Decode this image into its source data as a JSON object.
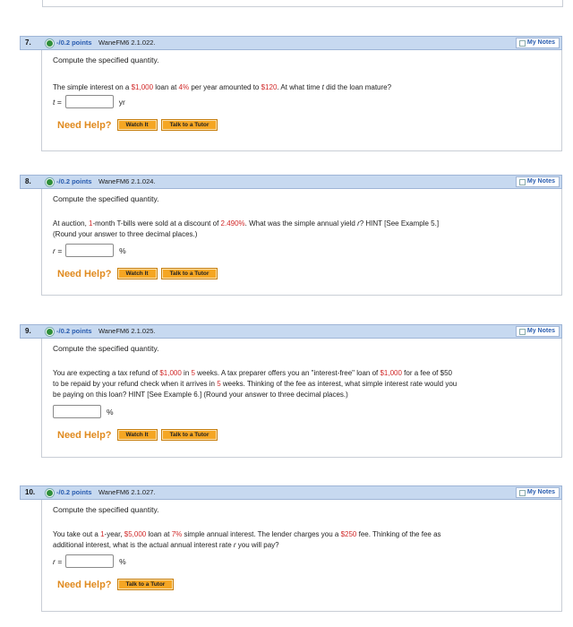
{
  "questions": [
    {
      "number": "7.",
      "points": "-/0.2 points",
      "code": "WaneFM6 2.1.022.",
      "my_notes": "My Notes",
      "prompt": "Compute the specified quantity.",
      "text_segments": [
        {
          "t": "The simple interest on a ",
          "style": ""
        },
        {
          "t": "$1,000",
          "style": "red"
        },
        {
          "t": " loan at ",
          "style": ""
        },
        {
          "t": "4%",
          "style": "red"
        },
        {
          "t": " per year amounted to ",
          "style": ""
        },
        {
          "t": "$120",
          "style": "red"
        },
        {
          "t": ". At what time ",
          "style": ""
        },
        {
          "t": "t",
          "style": "var"
        },
        {
          "t": " did the loan mature?",
          "style": ""
        }
      ],
      "answer_prefix": "t =",
      "answer_unit": "yr",
      "answer_value": "",
      "need_help": "Need Help?",
      "buttons": [
        "Watch It",
        "Talk to a Tutor"
      ]
    },
    {
      "number": "8.",
      "points": "-/0.2 points",
      "code": "WaneFM6 2.1.024.",
      "my_notes": "My Notes",
      "prompt": "Compute the specified quantity.",
      "text_segments": [
        {
          "t": "At auction, ",
          "style": ""
        },
        {
          "t": "1",
          "style": "red"
        },
        {
          "t": "-month T-bills were sold at a discount of ",
          "style": ""
        },
        {
          "t": "2.490%",
          "style": "red"
        },
        {
          "t": ". What was the simple annual yield ",
          "style": ""
        },
        {
          "t": "r",
          "style": "var"
        },
        {
          "t": "? HINT [See Example 5.]",
          "style": ""
        },
        {
          "t": "\n(Round your answer to three decimal places.)",
          "style": ""
        }
      ],
      "answer_prefix": "r =",
      "answer_unit": "%",
      "answer_value": "",
      "need_help": "Need Help?",
      "buttons": [
        "Watch It",
        "Talk to a Tutor"
      ]
    },
    {
      "number": "9.",
      "points": "-/0.2 points",
      "code": "WaneFM6 2.1.025.",
      "my_notes": "My Notes",
      "prompt": "Compute the specified quantity.",
      "text_segments": [
        {
          "t": "You are expecting a tax refund of ",
          "style": ""
        },
        {
          "t": "$1,000",
          "style": "red"
        },
        {
          "t": " in ",
          "style": ""
        },
        {
          "t": "5",
          "style": "red"
        },
        {
          "t": " weeks. A tax preparer offers you an \"interest-free\" loan of ",
          "style": ""
        },
        {
          "t": "$1,000",
          "style": "red"
        },
        {
          "t": " for a fee of $50",
          "style": ""
        },
        {
          "t": "\nto be repaid by your refund check when it arrives in ",
          "style": ""
        },
        {
          "t": "5",
          "style": "red"
        },
        {
          "t": " weeks. Thinking of the fee as interest, what simple interest rate would you",
          "style": ""
        },
        {
          "t": "\nbe paying on this loan? HINT [See Example 6.] (Round your answer to three decimal places.)",
          "style": ""
        }
      ],
      "answer_prefix": "",
      "answer_unit": "%",
      "answer_value": "",
      "need_help": "Need Help?",
      "buttons": [
        "Watch It",
        "Talk to a Tutor"
      ]
    },
    {
      "number": "10.",
      "points": "-/0.2 points",
      "code": "WaneFM6 2.1.027.",
      "my_notes": "My Notes",
      "prompt": "Compute the specified quantity.",
      "text_segments": [
        {
          "t": "You take out a ",
          "style": ""
        },
        {
          "t": "1",
          "style": "red"
        },
        {
          "t": "-year, ",
          "style": ""
        },
        {
          "t": "$5,000",
          "style": "red"
        },
        {
          "t": " loan at ",
          "style": ""
        },
        {
          "t": "7%",
          "style": "red"
        },
        {
          "t": " simple annual interest. The lender charges you a ",
          "style": ""
        },
        {
          "t": "$250",
          "style": "red"
        },
        {
          "t": " fee. Thinking of the fee as",
          "style": ""
        },
        {
          "t": "\nadditional interest, what is the actual annual interest rate ",
          "style": ""
        },
        {
          "t": "r",
          "style": "var"
        },
        {
          "t": " you will pay?",
          "style": ""
        }
      ],
      "answer_prefix": "r =",
      "answer_unit": "%",
      "answer_value": "",
      "need_help": "Need Help?",
      "buttons": [
        "Talk to a Tutor"
      ]
    }
  ],
  "colors": {
    "header_bg": "#c7d9f0",
    "points_blue": "#2a5db0",
    "value_red": "#d12a2a",
    "help_orange": "#e08a1e",
    "button_orange": "#f5a623"
  }
}
